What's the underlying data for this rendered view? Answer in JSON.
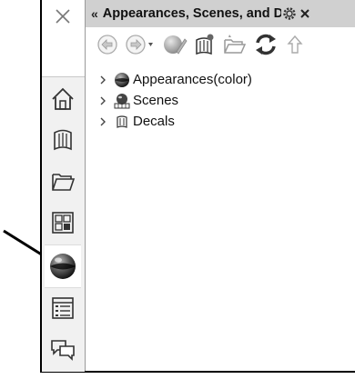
{
  "panel": {
    "title": "Appearances, Scenes, and Decals",
    "collapse_label": "«"
  },
  "toolbar": {
    "tools": [
      "back",
      "forward",
      "add-appearance",
      "add-library",
      "add-folder",
      "refresh",
      "up"
    ]
  },
  "tree": {
    "items": [
      {
        "label": "Appearances(color)",
        "icon": "appearance-sphere-icon"
      },
      {
        "label": "Scenes",
        "icon": "scene-icon"
      },
      {
        "label": "Decals",
        "icon": "decal-icon"
      }
    ]
  },
  "sidebar": {
    "tabs": [
      "home-icon",
      "design-library-icon",
      "file-explorer-icon",
      "view-palette-icon",
      "appearances-icon",
      "custom-properties-icon",
      "forum-icon"
    ],
    "active_tab": "appearances-icon"
  }
}
